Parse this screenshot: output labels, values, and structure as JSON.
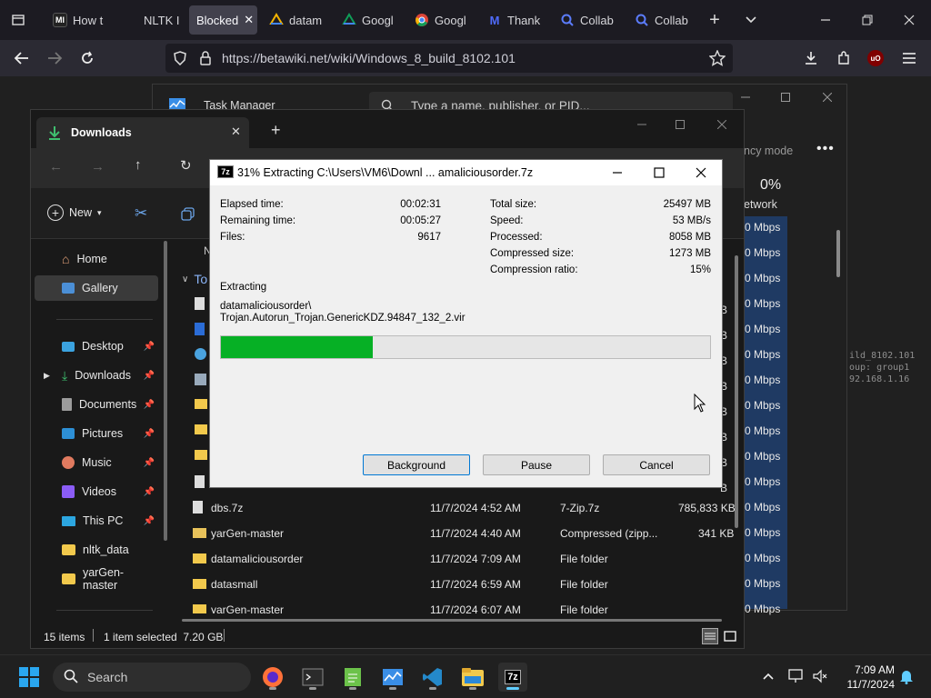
{
  "browser": {
    "tabs": [
      {
        "label": "How t",
        "favicon": "MI"
      },
      {
        "label": "NLTK I",
        "favicon": ""
      },
      {
        "label": "Blocked",
        "favicon": ""
      },
      {
        "label": "datam",
        "favicon": "drive"
      },
      {
        "label": "Googl",
        "favicon": "drive"
      },
      {
        "label": "Googl",
        "favicon": "chrome"
      },
      {
        "label": "Thank",
        "favicon": "M"
      },
      {
        "label": "Collab",
        "favicon": "search"
      },
      {
        "label": "Collab",
        "favicon": "search"
      }
    ],
    "url": "https://betawiki.net/wiki/Windows_8_build_8102.101",
    "extension_badge": "uO"
  },
  "taskmgr": {
    "title": "Task Manager",
    "search_placeholder": "Type a name, publisher, or PID...",
    "efficiency_label": "ncy mode",
    "network_percent": "0%",
    "network_label": "etwork",
    "network_values": [
      "0 Mbps",
      "0 Mbps",
      "0 Mbps",
      "0 Mbps",
      "0 Mbps",
      "0 Mbps",
      "0 Mbps",
      "0 Mbps",
      "0 Mbps",
      "0 Mbps",
      "0 Mbps",
      "0 Mbps",
      "0 Mbps",
      "0 Mbps",
      "0 Mbps",
      "0 Mbps"
    ],
    "mono_lines": [
      "ild_8102.101",
      "oup: group1",
      "92.168.1.16"
    ]
  },
  "explorer": {
    "title": "Downloads",
    "new_label": "New",
    "nav": [
      {
        "label": "Home",
        "pinned": false
      },
      {
        "label": "Gallery",
        "pinned": false
      },
      {
        "label": "Desktop",
        "pinned": true
      },
      {
        "label": "Downloads",
        "pinned": true
      },
      {
        "label": "Documents",
        "pinned": true
      },
      {
        "label": "Pictures",
        "pinned": true
      },
      {
        "label": "Music",
        "pinned": true
      },
      {
        "label": "Videos",
        "pinned": true
      },
      {
        "label": "This PC",
        "pinned": true
      },
      {
        "label": "nltk_data",
        "pinned": false
      },
      {
        "label": "yarGen-master",
        "pinned": false
      }
    ],
    "column_head_n": "N",
    "group_label": "To",
    "partial_sizes": [
      "B",
      "B",
      "B",
      "B",
      "B",
      "B",
      "B",
      "B"
    ],
    "files": [
      {
        "name": "dbs.7z",
        "date": "11/7/2024 4:52 AM",
        "type": "7-Zip.7z",
        "size": "785,833 KB"
      },
      {
        "name": "yarGen-master",
        "date": "11/7/2024 4:40 AM",
        "type": "Compressed (zipp...",
        "size": "341 KB"
      },
      {
        "name": "datamaliciousorder",
        "date": "11/7/2024 7:09 AM",
        "type": "File folder",
        "size": ""
      },
      {
        "name": "datasmall",
        "date": "11/7/2024 6:59 AM",
        "type": "File folder",
        "size": ""
      },
      {
        "name": "yarGen-master",
        "date": "11/7/2024 6:07 AM",
        "type": "File folder",
        "size": ""
      }
    ],
    "status_items": "15 items",
    "status_selected": "1 item selected  7.20 GB"
  },
  "zip": {
    "title": "31% Extracting C:\\Users\\VM6\\Downl ... amaliciousorder.7z",
    "left": [
      {
        "label": "Elapsed time:",
        "value": "00:02:31"
      },
      {
        "label": "Remaining time:",
        "value": "00:05:27"
      },
      {
        "label": "Files:",
        "value": "9617"
      }
    ],
    "right": [
      {
        "label": "Total size:",
        "value": "25497 MB"
      },
      {
        "label": "Speed:",
        "value": "53 MB/s"
      },
      {
        "label": "Processed:",
        "value": "8058 MB"
      },
      {
        "label": "Compressed size:",
        "value": "1273 MB"
      },
      {
        "label": "Compression ratio:",
        "value": "15%"
      }
    ],
    "extracting_label": "Extracting",
    "path_line1": "datamaliciousorder\\",
    "path_line2": "Trojan.Autorun_Trojan.GenericKDZ.94847_132_2.vir",
    "progress": 0.31,
    "buttons": {
      "background": "Background",
      "pause": "Pause",
      "cancel": "Cancel"
    }
  },
  "taskbar": {
    "search_label": "Search",
    "time": "7:09 AM",
    "date": "11/7/2024"
  },
  "colors": {
    "progress_fill": "#06b025",
    "accent": "#0078d4"
  }
}
